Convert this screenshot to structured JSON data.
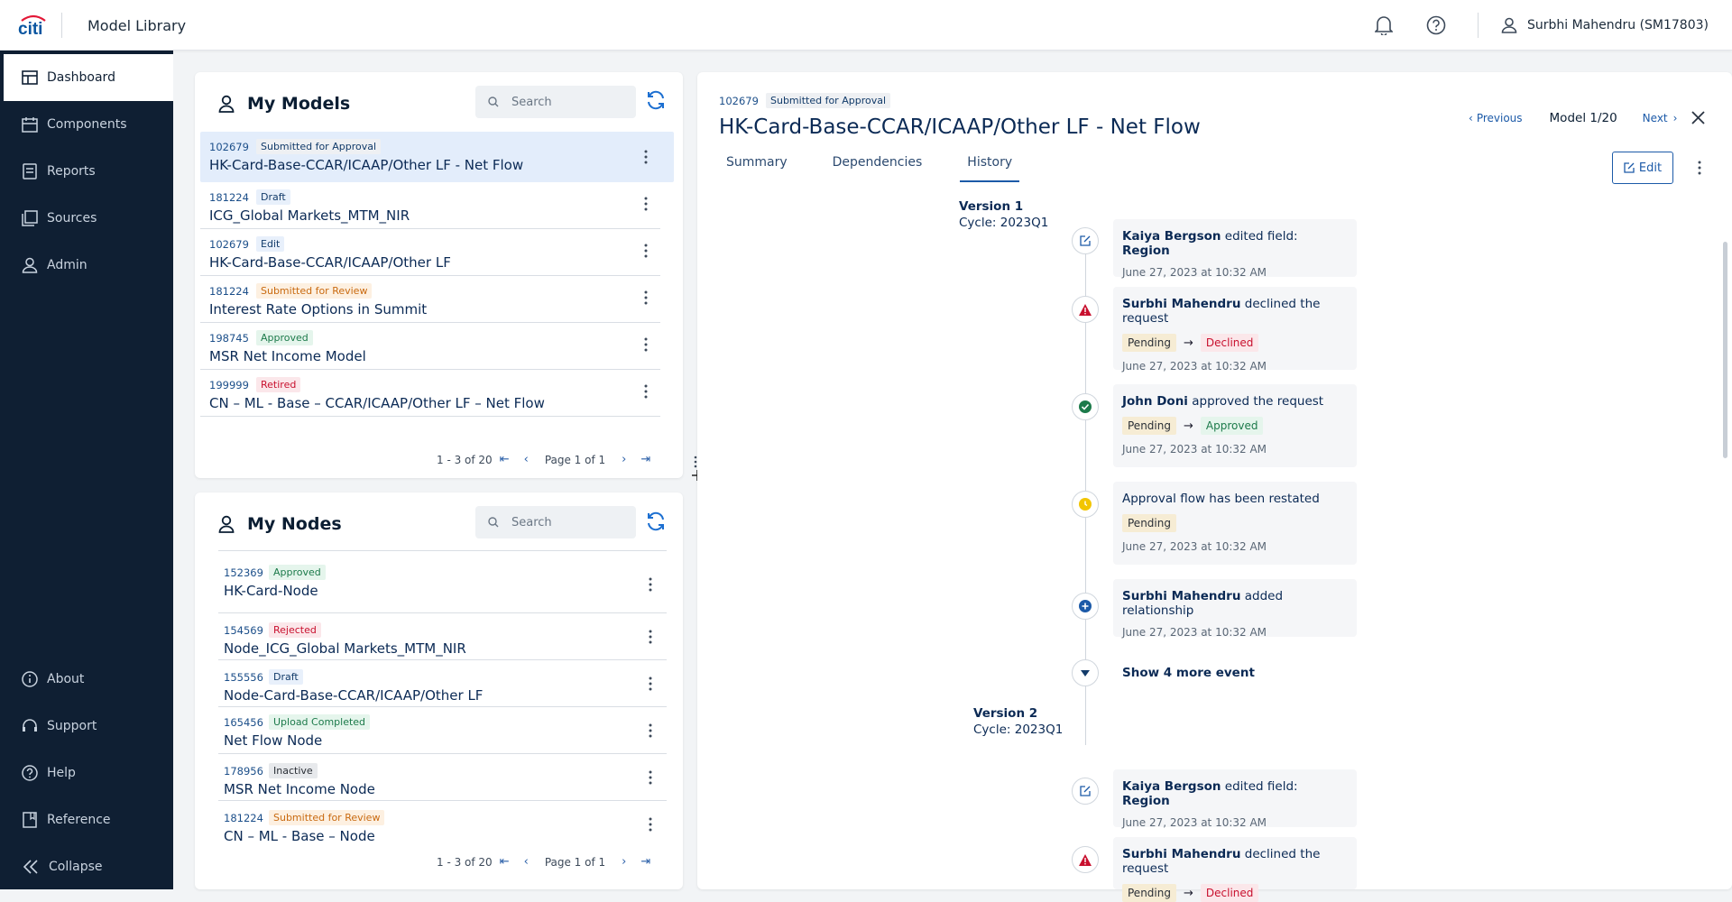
{
  "header": {
    "app_title": "Model Library",
    "user": "Surbhi Mahendru (SM17803)",
    "logo_text": "citi"
  },
  "sidebar": {
    "items": [
      {
        "label": "Dashboard",
        "icon": "dashboard-icon",
        "active": true
      },
      {
        "label": "Components",
        "icon": "components-icon"
      },
      {
        "label": "Reports",
        "icon": "reports-icon"
      },
      {
        "label": "Sources",
        "icon": "sources-icon"
      },
      {
        "label": "Admin",
        "icon": "user-icon"
      }
    ],
    "bottom_items": [
      {
        "label": "About",
        "icon": "info-icon"
      },
      {
        "label": "Support",
        "icon": "headset-icon"
      },
      {
        "label": "Help",
        "icon": "help-icon"
      },
      {
        "label": "Reference",
        "icon": "reference-icon"
      },
      {
        "label": "Collapse",
        "icon": "collapse-icon"
      }
    ]
  },
  "models": {
    "title": "My Models",
    "search_placeholder": "Search",
    "rows": [
      {
        "id": "102679",
        "status": "Submitted for Approval",
        "name": "HK-Card-Base-CCAR/ICAAP/Other LF - Net Flow"
      },
      {
        "id": "181224",
        "status": "Draft",
        "name": "ICG_Global Markets_MTM_NIR"
      },
      {
        "id": "102679",
        "status": "Edit",
        "name": "HK-Card-Base-CCAR/ICAAP/Other LF"
      },
      {
        "id": "181224",
        "status": "Submitted for Review",
        "name": "Interest Rate Options in Summit"
      },
      {
        "id": "198745",
        "status": "Approved",
        "name": "MSR Net Income Model"
      },
      {
        "id": "199999",
        "status": "Retired",
        "name": "CN – ML - Base – CCAR/ICAAP/Other LF – Net Flow"
      }
    ],
    "range": "1 - 3 of 20",
    "page": "Page 1 of 1"
  },
  "nodes": {
    "title": "My Nodes",
    "search_placeholder": "Search",
    "rows": [
      {
        "id": "152369",
        "status": "Approved",
        "name": "HK-Card-Node"
      },
      {
        "id": "154569",
        "status": "Rejected",
        "name": "Node_ICG_Global Markets_MTM_NIR"
      },
      {
        "id": "155556",
        "status": "Draft",
        "name": "Node-Card-Base-CCAR/ICAAP/Other LF"
      },
      {
        "id": "165456",
        "status": "Upload Completed",
        "name": "Net Flow Node"
      },
      {
        "id": "178956",
        "status": "Inactive",
        "name": "MSR Net Income Node"
      },
      {
        "id": "181224",
        "status": "Submitted for Review",
        "name": "CN – ML - Base – Node"
      }
    ],
    "range": "1 - 3 of 20",
    "page": "Page 1 of 1"
  },
  "detail": {
    "id": "102679",
    "status": "Submitted for Approval",
    "title": "HK-Card-Base-CCAR/ICAAP/Other LF - Net Flow",
    "prev_label": "Previous",
    "next_label": "Next",
    "model_counter": "Model 1/20",
    "edit_label": "Edit",
    "tabs": [
      "Summary",
      "Dependencies",
      "History"
    ],
    "active_tab": "History",
    "versions": [
      {
        "label": "Version 1",
        "cycle": "Cycle: 2023Q1"
      },
      {
        "label": "Version 2",
        "cycle": "Cycle: 2023Q1"
      }
    ],
    "events": [
      {
        "actor": "Kaiya Bergson",
        "action": "edited field:",
        "field": "Region",
        "date": "June 27, 2023 at 10:32 AM",
        "icon": "edit-icon"
      },
      {
        "actor": "Surbhi Mahendru",
        "action": "declined the request",
        "from": "Pending",
        "to": "Declined",
        "date": "June 27, 2023 at 10:32 AM",
        "icon": "warning-icon"
      },
      {
        "actor": "John Doni",
        "action": "approved the request",
        "from": "Pending",
        "to": "Approved",
        "date": "June 27, 2023 at 10:32 AM",
        "icon": "check-icon"
      },
      {
        "actor": "",
        "action": "Approval flow has been restated",
        "from": "Pending",
        "date": "June 27, 2023 at 10:32 AM",
        "icon": "pending-icon"
      },
      {
        "actor": "Surbhi Mahendru",
        "action": "added relationship",
        "date": "June 27, 2023 at 10:32 AM",
        "icon": "plus-icon"
      }
    ],
    "show_more": "Show 4 more event",
    "events_v2": [
      {
        "actor": "Kaiya Bergson",
        "action": "edited field:",
        "field": "Region",
        "date": "June 27, 2023 at 10:32 AM",
        "icon": "edit-icon"
      },
      {
        "actor": "Surbhi Mahendru",
        "action": "declined the request",
        "from": "Pending",
        "to": "Declined",
        "icon": "warning-icon"
      }
    ],
    "arrow": "→"
  },
  "colors": {
    "sidebar_bg": "#0f1f33",
    "accent": "#1c5aa8",
    "approved": "#1c7a4a",
    "declined": "#c8102e",
    "pending_bg": "#f6ecd4"
  }
}
